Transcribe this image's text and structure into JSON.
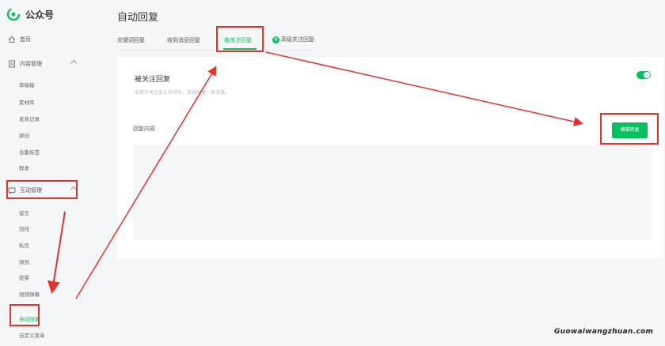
{
  "sidebar": {
    "logo_text": "公众号",
    "home": "首页",
    "content_mgmt": "内容管理",
    "content_items": [
      "草稿箱",
      "素材库",
      "发表记录",
      "原创",
      "合集标签",
      "群发"
    ],
    "interact_mgmt": "互动管理",
    "interact_items": [
      "留言",
      "划线",
      "私信",
      "弹到",
      "投票",
      "视频弹幕",
      "自动回复",
      "自定义菜单"
    ],
    "active_item": "自动回复"
  },
  "header": {
    "title": "自动回复"
  },
  "tabs": [
    "关键词回复",
    "收到消息回复",
    "被关注回复",
    "高级关注回复"
  ],
  "advanced_badge": "V",
  "panel": {
    "title": "被关注回复",
    "description": "当用户关注此公众号时，自动回复一条消息。",
    "content_label": "回复内容",
    "edit_button": "编辑回复",
    "toggle_on": true
  },
  "watermark": "Guowaiwangzhuan.com",
  "colors": {
    "accent": "#07c160",
    "annotation": "#e2322c",
    "background": "#f5f6f7"
  }
}
